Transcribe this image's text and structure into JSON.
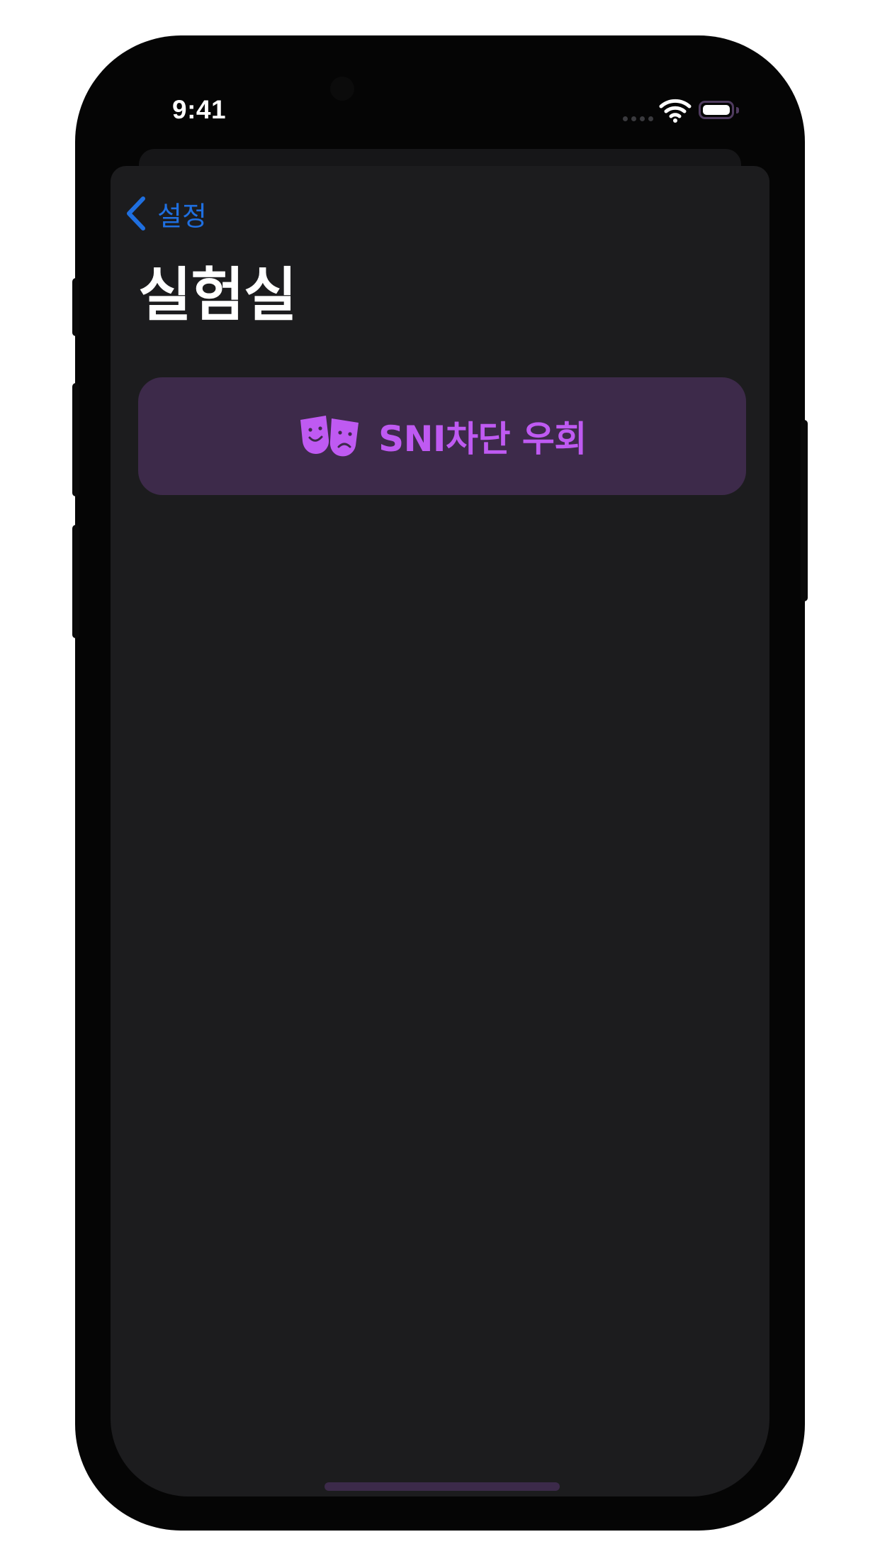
{
  "status_bar": {
    "time": "9:41",
    "wifi_icon": "wifi-icon",
    "battery_icon": "battery-icon"
  },
  "navigation": {
    "back_label": "설정",
    "back_icon": "chevron-left-icon"
  },
  "page": {
    "title": "실험실"
  },
  "features": [
    {
      "label": "SNI차단 우회",
      "icon": "theater-masks-icon"
    }
  ],
  "colors": {
    "accent_blue": "#1f6fe0",
    "accent_purple": "#bf5af2",
    "card_background": "#3d2a4a",
    "screen_background": "#1c1c1e"
  }
}
